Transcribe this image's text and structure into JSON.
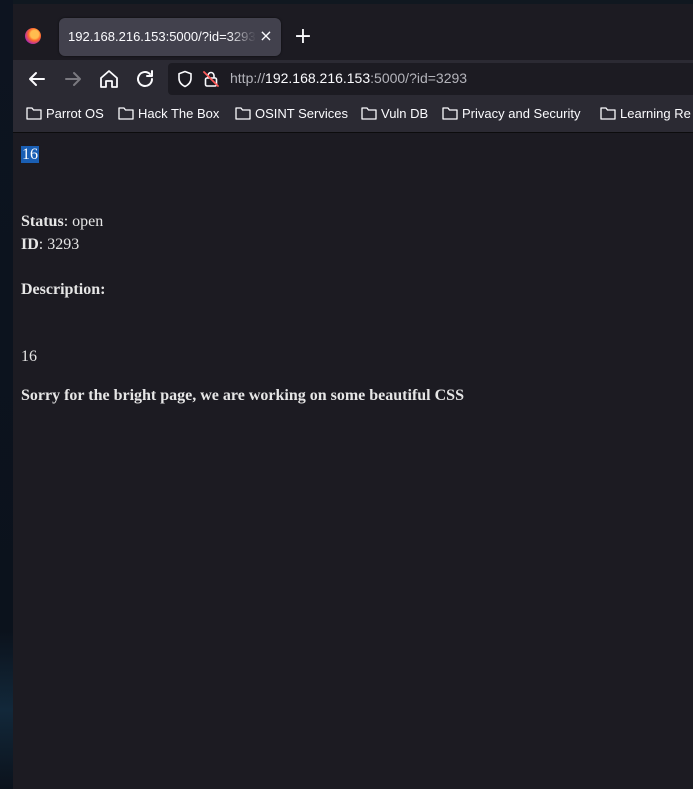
{
  "browser": {
    "tab_title": "192.168.216.153:5000/?id=3293",
    "tab_close": "×",
    "new_tab": "+",
    "url_scheme": "http://",
    "url_host": "192.168.216.153",
    "url_rest": ":5000/?id=3293"
  },
  "bookmarks": [
    {
      "label": "Parrot OS"
    },
    {
      "label": "Hack The Box"
    },
    {
      "label": "OSINT Services"
    },
    {
      "label": "Vuln DB"
    },
    {
      "label": "Privacy and Security"
    },
    {
      "label": "Learning Re"
    }
  ],
  "page": {
    "selected_text": "16",
    "status_label": "Status",
    "status_value": ": open",
    "id_label": "ID",
    "id_value": ": 3293",
    "description_label": "Description:",
    "description_value": "16",
    "footer_note": "Sorry for the bright page, we are working on some beautiful CSS"
  },
  "colors": {
    "selection": "#1a5fb4",
    "page_bg": "#1c1b22",
    "toolbar_bg": "#2b2a33"
  }
}
